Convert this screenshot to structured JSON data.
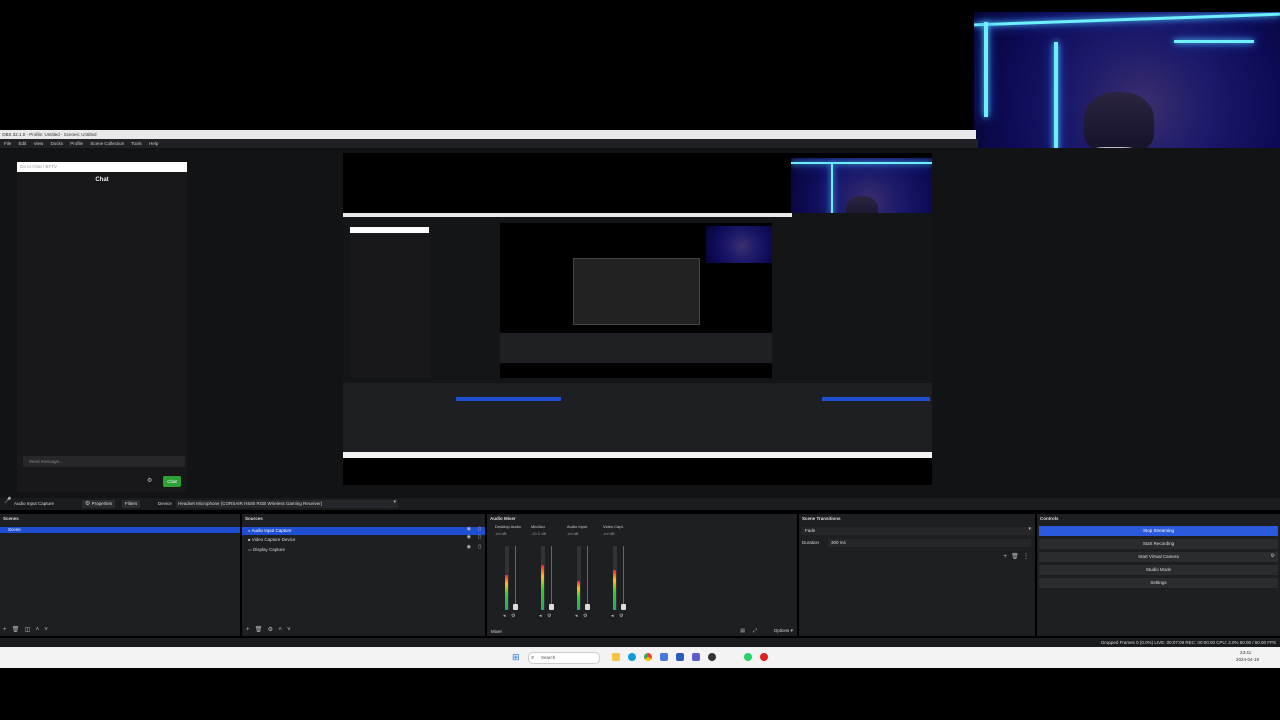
{
  "window": {
    "title": "OBS 32.1.0 - Profile: Untitled - Scenes: Untitled",
    "menu": [
      "File",
      "Edit",
      "View",
      "Docks",
      "Profile",
      "Scene Collection",
      "Tools",
      "Help"
    ]
  },
  "chat": {
    "tab_label": "Go to Chat / BTTV",
    "title": "Chat",
    "placeholder": "Send message...",
    "send_label": "Chat"
  },
  "source_toolbar": {
    "source_name": "Audio Input Capture",
    "properties_label": "Properties",
    "filters_label": "Filters",
    "device_label": "Device",
    "device_value": "Headset Microphone (CORSAIR HS80 RGB Wireless Gaming Receiver)"
  },
  "scenes": {
    "title": "Scenes",
    "items": [
      "Scene"
    ]
  },
  "sources": {
    "title": "Sources",
    "items": [
      "Audio Input Capture",
      "Video Capture Device",
      "Display Capture"
    ]
  },
  "audio_mixer": {
    "title": "Audio Mixer",
    "channels": [
      "Desktop Audio",
      "Mic/Aux",
      "Audio Input",
      "Video Capt."
    ],
    "db_values": [
      "-inf dB",
      "-10.2 dB",
      "-inf dB",
      "-inf dB"
    ],
    "levels": [
      0.55,
      0.7,
      0.45,
      0.62
    ],
    "options_label": "Options",
    "bottom_label": "Mixer"
  },
  "transitions": {
    "title": "Scene Transitions",
    "type_value": "Fade",
    "duration_label": "Duration",
    "duration_value": "300 ms"
  },
  "controls": {
    "title": "Controls",
    "buttons": [
      "Stop Streaming",
      "Start Recording",
      "Start Virtual Camera",
      "Studio Mode",
      "Settings"
    ]
  },
  "status": {
    "left_text": "",
    "right_text": "Dropped Frames 0 (0.0%)   LIVE: 00:07:09   REC: 00:00:00   CPU: 2.0%   60.00 / 60.00 FPS"
  },
  "taskbar": {
    "search_placeholder": "Search",
    "clock_time": "23:41",
    "clock_date": "2024-04-19"
  },
  "colors": {
    "accent": "#1f4fd1",
    "led": "#6ff0ff",
    "obs_bg": "#1e1f22"
  }
}
